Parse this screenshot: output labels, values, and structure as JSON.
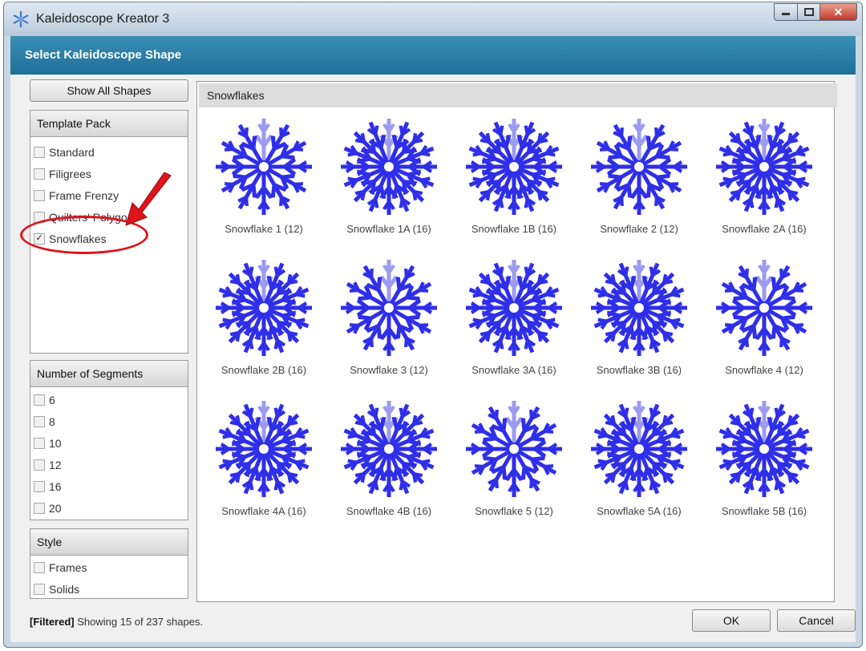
{
  "window": {
    "title": "Kaleidoscope Kreator 3",
    "header": "Select Kaleidoscope Shape"
  },
  "sidebar": {
    "show_all_label": "Show All Shapes",
    "template_pack": {
      "title": "Template Pack",
      "items": [
        {
          "label": "Standard",
          "checked": false
        },
        {
          "label": "Filigrees",
          "checked": false
        },
        {
          "label": "Frame Frenzy",
          "checked": false
        },
        {
          "label": "Quilters' Polygo",
          "checked": false
        },
        {
          "label": "Snowflakes",
          "checked": true
        }
      ]
    },
    "segments": {
      "title": "Number of Segments",
      "items": [
        {
          "label": "6",
          "checked": false
        },
        {
          "label": "8",
          "checked": false
        },
        {
          "label": "10",
          "checked": false
        },
        {
          "label": "12",
          "checked": false
        },
        {
          "label": "16",
          "checked": false
        },
        {
          "label": "20",
          "checked": false
        }
      ]
    },
    "style": {
      "title": "Style",
      "items": [
        {
          "label": "Frames",
          "checked": false
        },
        {
          "label": "Solids",
          "checked": false
        }
      ]
    }
  },
  "gallery": {
    "header": "Snowflakes",
    "tiles": [
      {
        "label": "Snowflake 1 (12)",
        "segments": 12
      },
      {
        "label": "Snowflake 1A (16)",
        "segments": 16
      },
      {
        "label": "Snowflake 1B (16)",
        "segments": 16
      },
      {
        "label": "Snowflake 2 (12)",
        "segments": 12
      },
      {
        "label": "Snowflake 2A (16)",
        "segments": 16
      },
      {
        "label": "Snowflake 2B (16)",
        "segments": 16
      },
      {
        "label": "Snowflake 3 (12)",
        "segments": 12
      },
      {
        "label": "Snowflake 3A (16)",
        "segments": 16
      },
      {
        "label": "Snowflake 3B (16)",
        "segments": 16
      },
      {
        "label": "Snowflake 4 (12)",
        "segments": 12
      },
      {
        "label": "Snowflake 4A (16)",
        "segments": 16
      },
      {
        "label": "Snowflake 4B (16)",
        "segments": 16
      },
      {
        "label": "Snowflake 5 (12)",
        "segments": 12
      },
      {
        "label": "Snowflake 5A (16)",
        "segments": 16
      },
      {
        "label": "Snowflake 5B (16)",
        "segments": 16
      }
    ]
  },
  "status": {
    "filtered": "[Filtered]",
    "text": "Showing 15 of 237 shapes."
  },
  "buttons": {
    "ok": "OK",
    "cancel": "Cancel"
  },
  "colors": {
    "snowflake": "#2f2ee8",
    "snowflake_accent": "#9c9bf0",
    "header": "#2a7fa8",
    "callout": "#e0131a"
  }
}
